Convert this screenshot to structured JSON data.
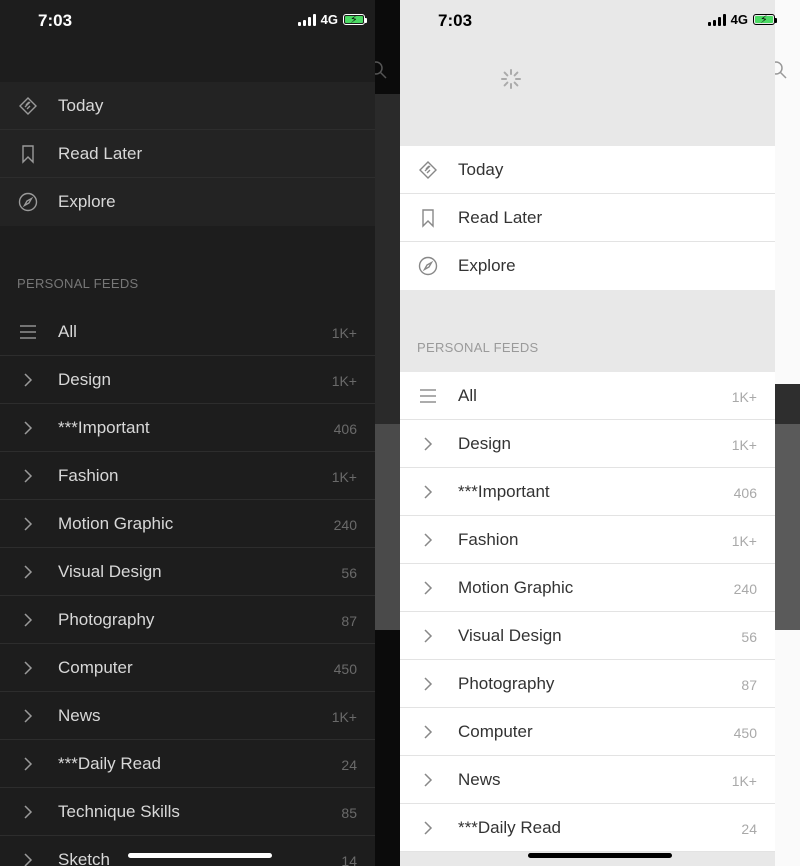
{
  "status": {
    "time": "7:03",
    "network": "4G"
  },
  "menu": {
    "today": "Today",
    "read_later": "Read Later",
    "explore": "Explore"
  },
  "section_title": "PERSONAL FEEDS",
  "feeds": [
    {
      "label": "All",
      "count": "1K+"
    },
    {
      "label": "Design",
      "count": "1K+"
    },
    {
      "label": "***Important",
      "count": "406"
    },
    {
      "label": "Fashion",
      "count": "1K+"
    },
    {
      "label": "Motion Graphic",
      "count": "240"
    },
    {
      "label": "Visual Design",
      "count": "56"
    },
    {
      "label": "Photography",
      "count": "87"
    },
    {
      "label": "Computer",
      "count": "450"
    },
    {
      "label": "News",
      "count": "1K+"
    },
    {
      "label": "***Daily Read",
      "count": "24"
    },
    {
      "label": "Technique Skills",
      "count": "85"
    },
    {
      "label": "Sketch",
      "count": "14"
    }
  ],
  "colors": {
    "dark_drawer": "#1d1d1d",
    "dark_text": "#d8d8d8",
    "light_drawer": "#e8e8e8",
    "light_text": "#333333",
    "battery": "#4cd964"
  },
  "icons": {
    "today": "feedly-icon",
    "read_later": "bookmark-icon",
    "explore": "compass-icon",
    "all": "list-icon",
    "feed": "chevron-right-icon"
  }
}
